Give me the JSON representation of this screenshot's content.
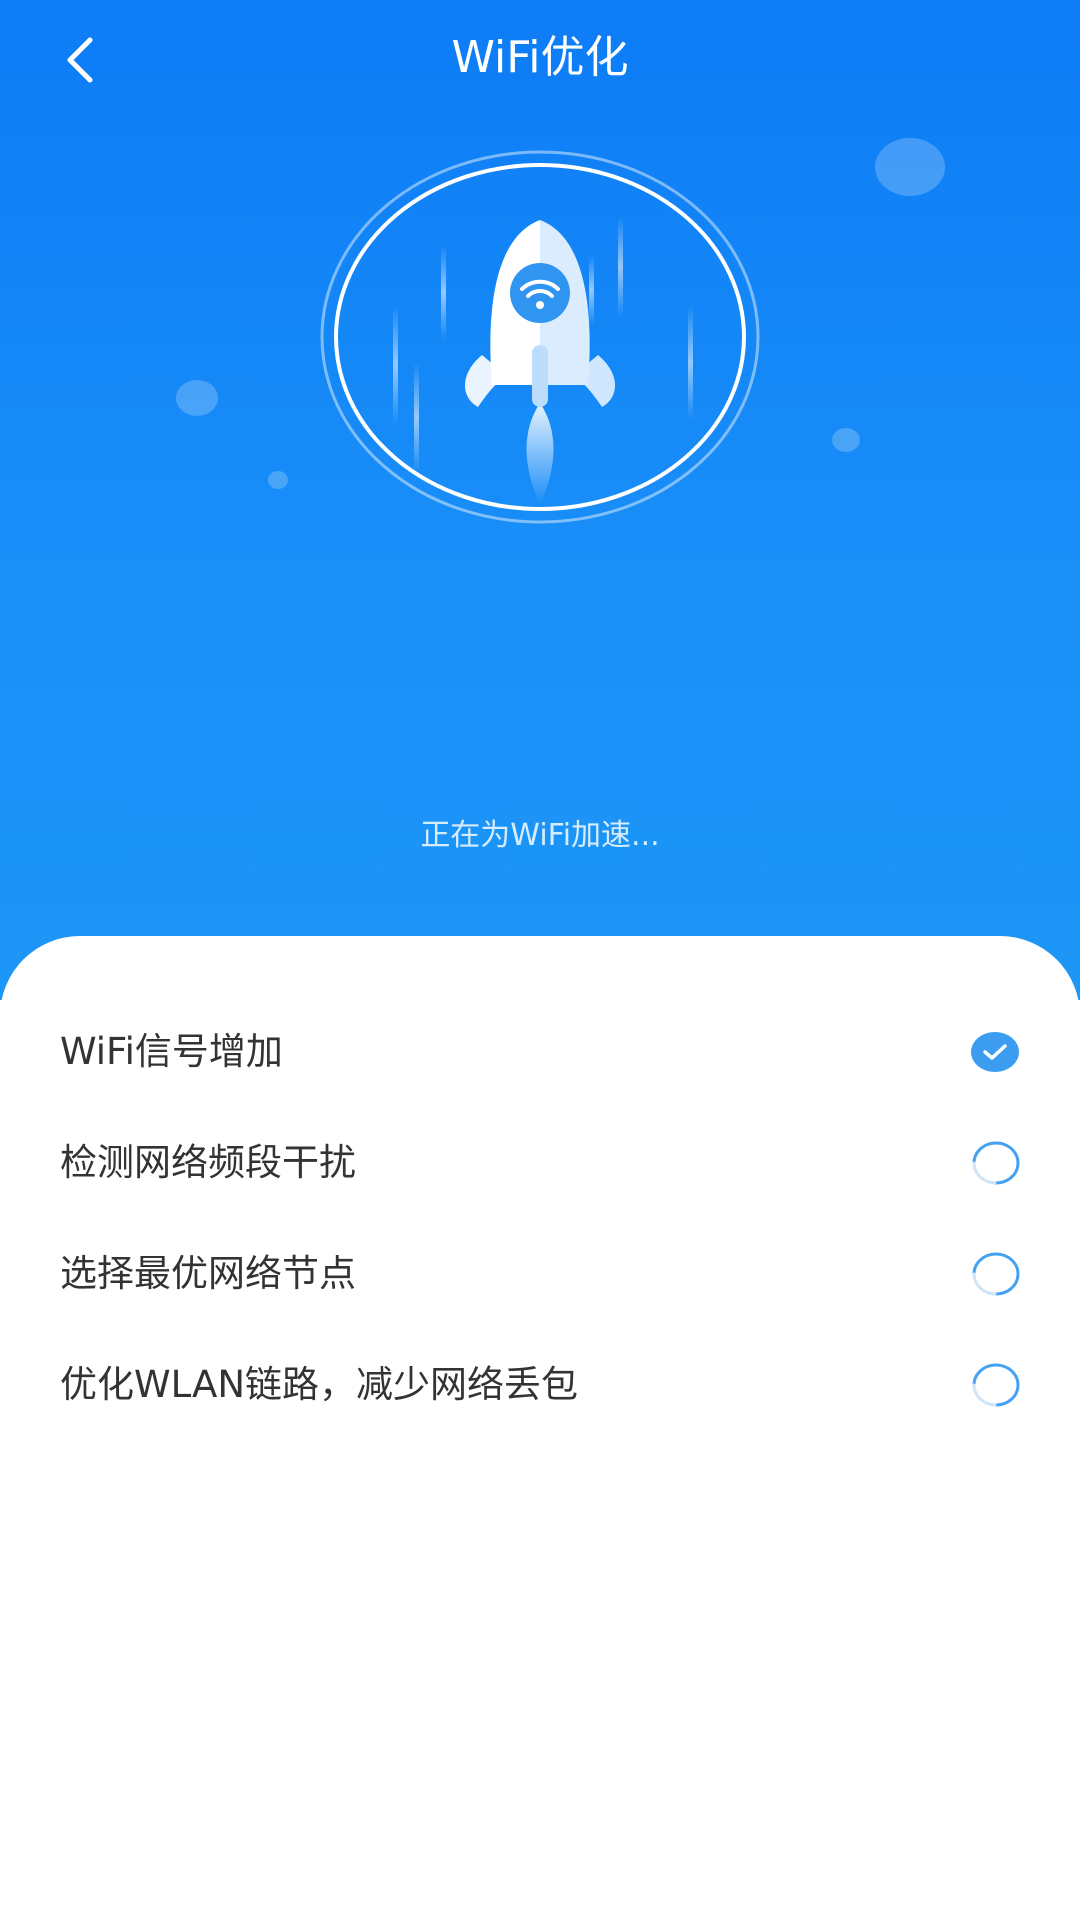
{
  "header": {
    "title": "WiFi优化",
    "back_icon": "chevron-left-icon"
  },
  "hero": {
    "illustration": "rocket-wifi-icon",
    "status_text": "正在为WiFi加速..."
  },
  "tasks": [
    {
      "label": "WiFi信号增加",
      "status": "done",
      "status_icon": "checkmark-circle-icon"
    },
    {
      "label": "检测网络频段干扰",
      "status": "in-progress",
      "status_icon": "spinner-icon"
    },
    {
      "label": "选择最优网络节点",
      "status": "in-progress",
      "status_icon": "spinner-icon"
    },
    {
      "label": "优化WLAN链路，减少网络丢包",
      "status": "in-progress",
      "status_icon": "spinner-icon"
    }
  ],
  "colors": {
    "primary": "#0d7cf6",
    "check": "#3b9cf0",
    "text": "#333333"
  }
}
